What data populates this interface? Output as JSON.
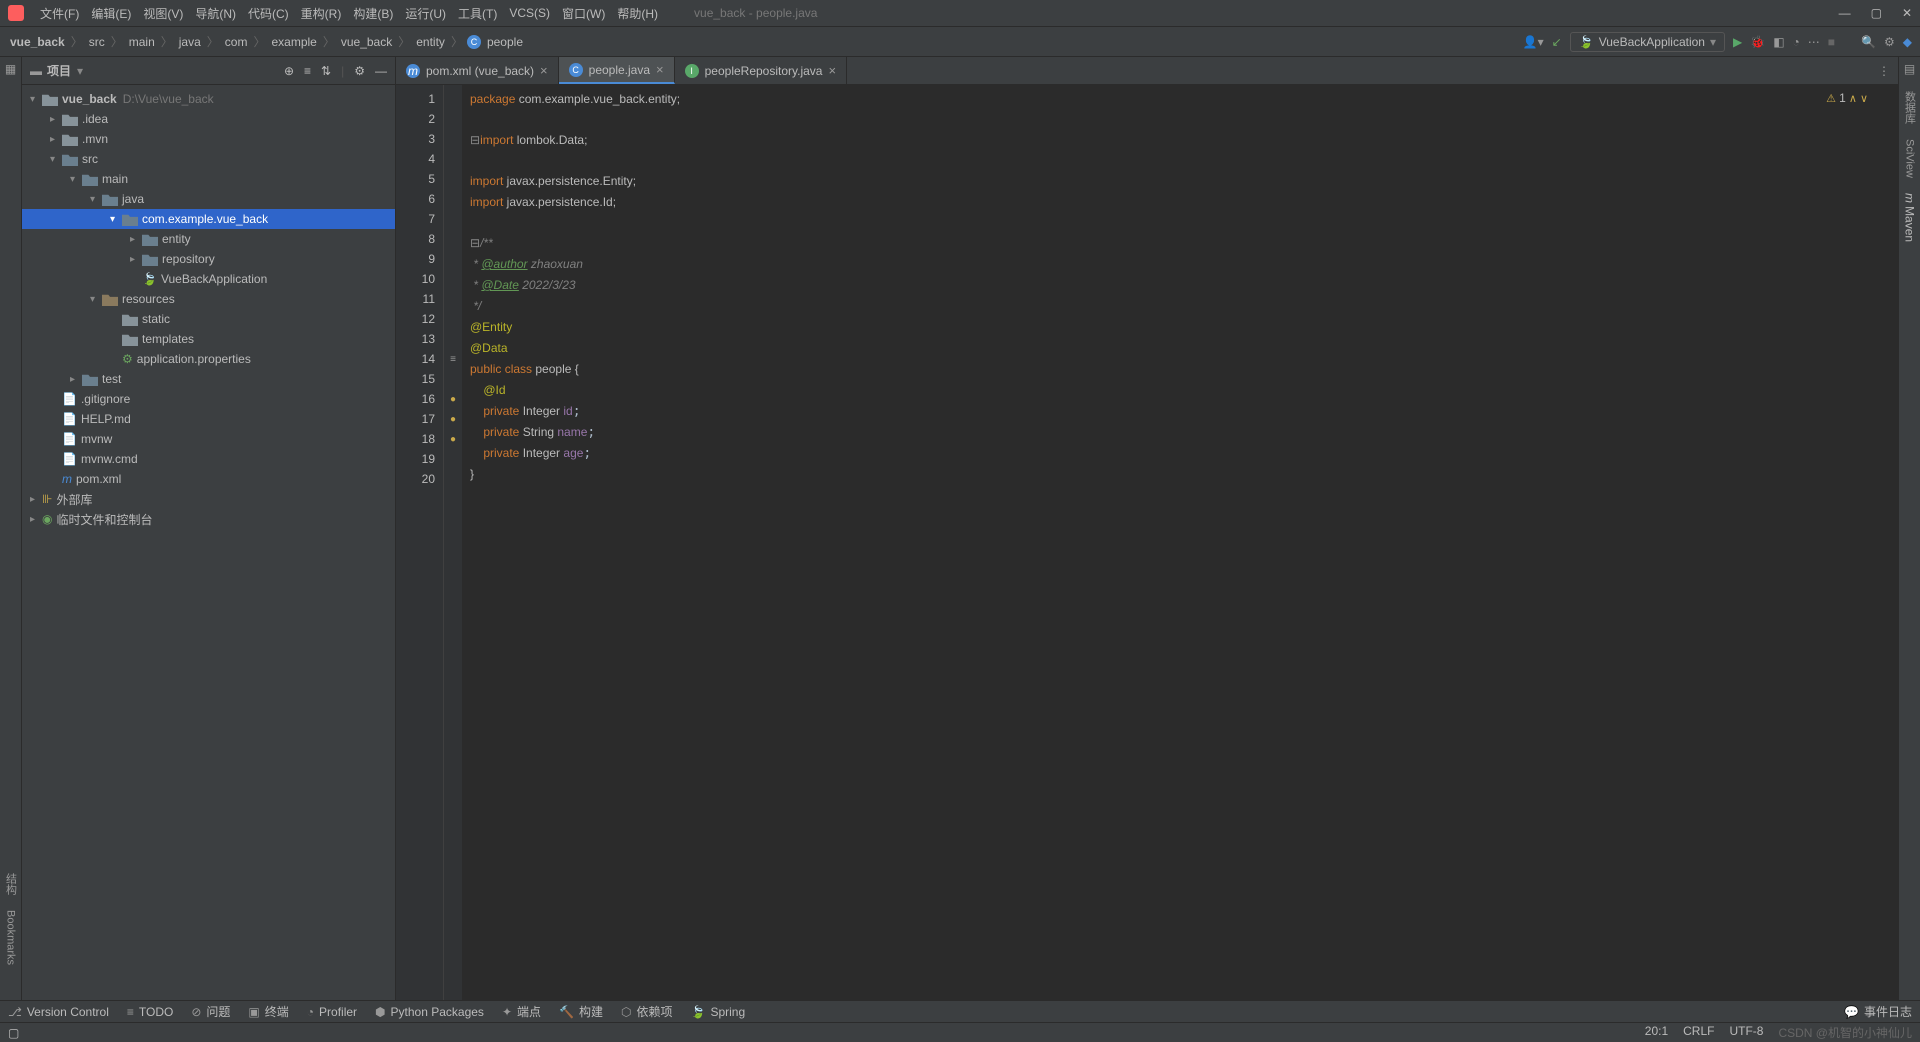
{
  "window_title": "vue_back - people.java",
  "menu": [
    "文件(F)",
    "编辑(E)",
    "视图(V)",
    "导航(N)",
    "代码(C)",
    "重构(R)",
    "构建(B)",
    "运行(U)",
    "工具(T)",
    "VCS(S)",
    "窗口(W)",
    "帮助(H)"
  ],
  "breadcrumb": [
    "vue_back",
    "src",
    "main",
    "java",
    "com",
    "example",
    "vue_back",
    "entity",
    "people"
  ],
  "run_config": "VueBackApplication",
  "sidebar_title": "项目",
  "tree": {
    "root": {
      "name": "vue_back",
      "path": "D:\\Vue\\vue_back"
    },
    "idea": ".idea",
    "mvn": ".mvn",
    "src": "src",
    "main": "main",
    "java": "java",
    "pkg": "com.example.vue_back",
    "entity": "entity",
    "repository": "repository",
    "app": "VueBackApplication",
    "resources": "resources",
    "static": "static",
    "templates": "templates",
    "props": "application.properties",
    "test": "test",
    "gitignore": ".gitignore",
    "help": "HELP.md",
    "mvnw": "mvnw",
    "mvnwcmd": "mvnw.cmd",
    "pom": "pom.xml",
    "ext": "外部库",
    "scratch": "临时文件和控制台"
  },
  "tabs": [
    {
      "label": "pom.xml (vue_back)",
      "icon": "m"
    },
    {
      "label": "people.java",
      "icon": "c",
      "active": true
    },
    {
      "label": "peopleRepository.java",
      "icon": "i"
    }
  ],
  "gutter_lines": [
    "1",
    "2",
    "3",
    "4",
    "5",
    "6",
    "7",
    "8",
    "9",
    "10",
    "11",
    "12",
    "13",
    "14",
    "15",
    "16",
    "17",
    "18",
    "19",
    "20"
  ],
  "code": {
    "l1_pkg": "package",
    "l1_name": " com.example.vue_back.entity;",
    "l3_imp": "import",
    "l3_name": " lombok.Data;",
    "l5_imp": "import",
    "l5_name": " javax.persistence.Entity;",
    "l6_imp": "import",
    "l6_name": " javax.persistence.Id;",
    "l8": "/**",
    "l9_pre": " * ",
    "l9_tag": "@author",
    "l9_val": " zhaoxuan",
    "l10_pre": " * ",
    "l10_tag": "@Date",
    "l10_val": " 2022/3/23",
    "l11": " */",
    "l12": "@Entity",
    "l13": "@Data",
    "l14_a": "public ",
    "l14_b": "class ",
    "l14_c": "people {",
    "l15": "    @Id",
    "l16_a": "    private ",
    "l16_b": "Integer ",
    "l16_c": "id",
    "l17_a": "    private ",
    "l17_b": "String ",
    "l17_c": "name",
    "l18_a": "    private ",
    "l18_b": "Integer ",
    "l18_c": "age",
    "l19": "}"
  },
  "warning_count": "1",
  "bottom_tools": [
    "Version Control",
    "TODO",
    "问题",
    "终端",
    "Profiler",
    "Python Packages",
    "端点",
    "构建",
    "依赖项",
    "Spring"
  ],
  "event_log": "事件日志",
  "left_tabs": {
    "structure": "结构",
    "bookmarks": "Bookmarks"
  },
  "right_tabs": {
    "db": "数据库",
    "sciview": "SciView",
    "maven": "Maven"
  },
  "status": {
    "pos": "20:1",
    "crlf": "CRLF",
    "enc": "UTF-8",
    "watermark": "CSDN @机智的小神仙儿"
  }
}
